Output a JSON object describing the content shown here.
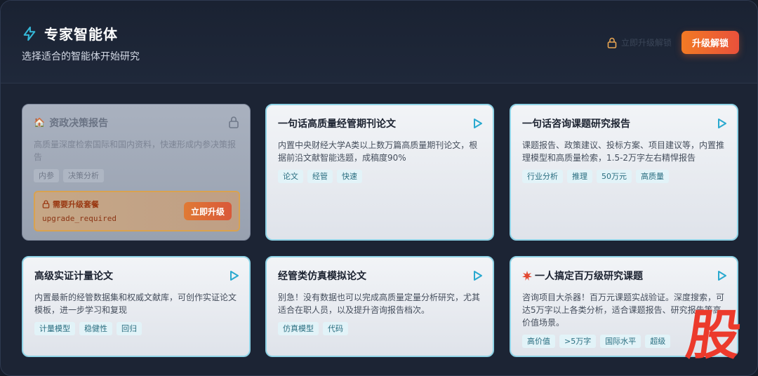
{
  "header": {
    "title": "专家智能体",
    "subtitle": "选择适合的智能体开始研究",
    "hint": "立即升级解锁",
    "upgrade_label": "升级解锁"
  },
  "colors": {
    "accent": "#35b8d8",
    "upgrade": "#f06c2c",
    "card_border": "#8fd3e6"
  },
  "cards": [
    {
      "title": "资政决策报告",
      "icon": "house-icon",
      "locked": true,
      "desc": "高质量深度检索国际和国内资料，快速形成内参决策报告",
      "tags": [
        "内参",
        "决策分析"
      ],
      "upgrade": {
        "title": "需要升级套餐",
        "code": "upgrade_required",
        "button": "立即升级"
      }
    },
    {
      "title": "一句话高质量经管期刊论文",
      "desc": "内置中央财经大学A类以上数万篇高质量期刊论文，根据前沿文献智能选题，成稿度90%",
      "tags": [
        "论文",
        "经管",
        "快速"
      ]
    },
    {
      "title": "一句话咨询课题研究报告",
      "desc": "课题报告、政策建议、投标方案、项目建议等，内置推理模型和高质量检索，1.5-2万字左右精悍报告",
      "tags": [
        "行业分析",
        "推理",
        "50万元",
        "高质量"
      ]
    },
    {
      "title": "高级实证计量论文",
      "desc": "内置最新的经管数据集和权威文献库，可创作实证论文模板，进一步学习和复现",
      "tags": [
        "计量模型",
        "稳健性",
        "回归"
      ]
    },
    {
      "title": "经管类仿真模拟论文",
      "desc": "别急！没有数据也可以完成高质量定量分析研究，尤其适合在职人员，以及提升咨询报告档次。",
      "tags": [
        "仿真模型",
        "代码"
      ]
    },
    {
      "title": "一人搞定百万级研究课题",
      "icon": "spark-icon",
      "desc": "咨询项目大杀器！百万元课题实战验证。深度搜索，可达5万字以上各类分析，适合课题报告、研究报告等高价值场景。",
      "tags": [
        "高价值",
        ">5万字",
        "国际水平",
        "超级"
      ]
    }
  ],
  "watermark": "股"
}
